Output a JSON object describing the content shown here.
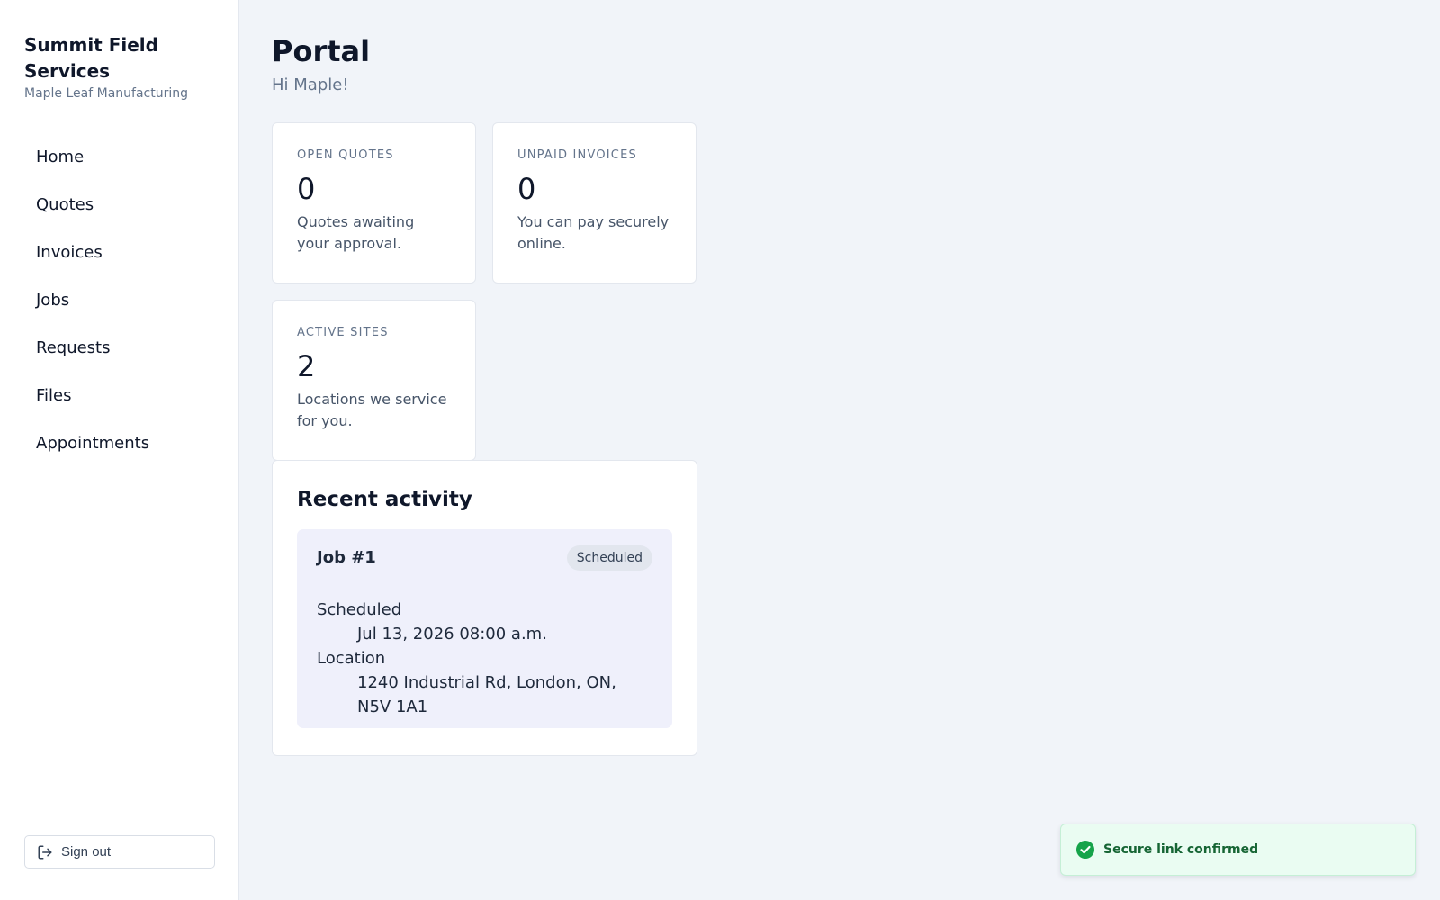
{
  "brand": {
    "name": "Summit Field Services",
    "organization": "Maple Leaf Manufacturing"
  },
  "nav": {
    "items": [
      {
        "label": "Home"
      },
      {
        "label": "Quotes"
      },
      {
        "label": "Invoices"
      },
      {
        "label": "Jobs"
      },
      {
        "label": "Requests"
      },
      {
        "label": "Files"
      },
      {
        "label": "Appointments"
      }
    ]
  },
  "signout": {
    "label": "Sign out",
    "icon": "sign-out-icon"
  },
  "header": {
    "title": "Portal",
    "greeting": "Hi Maple!"
  },
  "stats": [
    {
      "label": "OPEN QUOTES",
      "value": "0",
      "description": "Quotes awaiting your approval."
    },
    {
      "label": "UNPAID INVOICES",
      "value": "0",
      "description": "You can pay securely online."
    },
    {
      "label": "ACTIVE SITES",
      "value": "2",
      "description": "Locations we service for you."
    }
  ],
  "activity": {
    "title": "Recent activity",
    "items": [
      {
        "title": "Job #1",
        "status": "Scheduled",
        "scheduled_label": "Scheduled",
        "scheduled_value": "Jul 13, 2026 08:00 a.m.",
        "location_label": "Location",
        "location_value": "1240 Industrial Rd, London, ON, N5V 1A1"
      }
    ]
  },
  "toast": {
    "message": "Secure link confirmed",
    "icon": "check-circle-icon",
    "color": "#16a34a"
  }
}
